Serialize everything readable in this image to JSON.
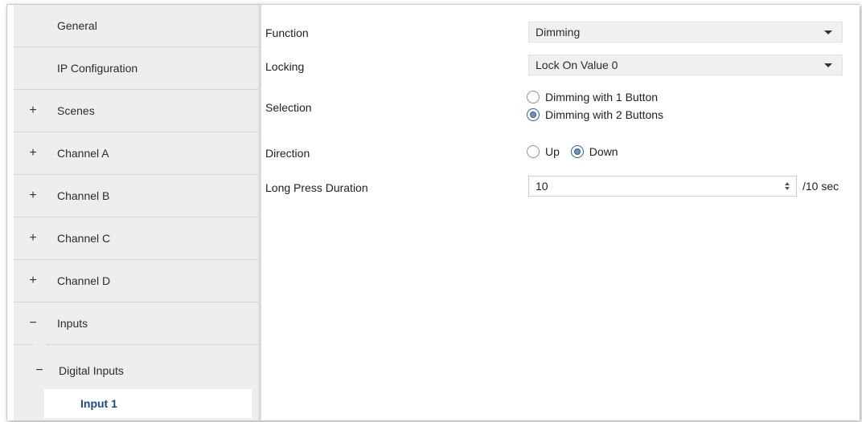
{
  "sidebar": {
    "items": [
      {
        "label": "General",
        "sign": ""
      },
      {
        "label": "IP Configuration",
        "sign": ""
      },
      {
        "label": "Scenes",
        "sign": "+"
      },
      {
        "label": "Channel A",
        "sign": "+"
      },
      {
        "label": "Channel B",
        "sign": "+"
      },
      {
        "label": "Channel C",
        "sign": "+"
      },
      {
        "label": "Channel D",
        "sign": "+"
      },
      {
        "label": "Inputs",
        "sign": "−"
      }
    ],
    "sub_item": {
      "label": "Digital Inputs",
      "sign": "−"
    },
    "selected_item": {
      "label": "Input 1"
    }
  },
  "form": {
    "function": {
      "label": "Function",
      "value": "Dimming"
    },
    "locking": {
      "label": "Locking",
      "value": "Lock On Value 0"
    },
    "selection": {
      "label": "Selection",
      "options": [
        "Dimming with 1 Button",
        "Dimming with 2 Buttons"
      ],
      "selected": "Dimming with 2 Buttons"
    },
    "direction": {
      "label": "Direction",
      "options": [
        "Up",
        "Down"
      ],
      "selected": "Down"
    },
    "long_press": {
      "label": "Long Press Duration",
      "value": "10",
      "unit": "/10 sec"
    }
  },
  "colors": {
    "sidebar_bg": "#eeeeee",
    "selected_text": "#1a4a8a",
    "radio_accent": "#2f5f9f"
  }
}
